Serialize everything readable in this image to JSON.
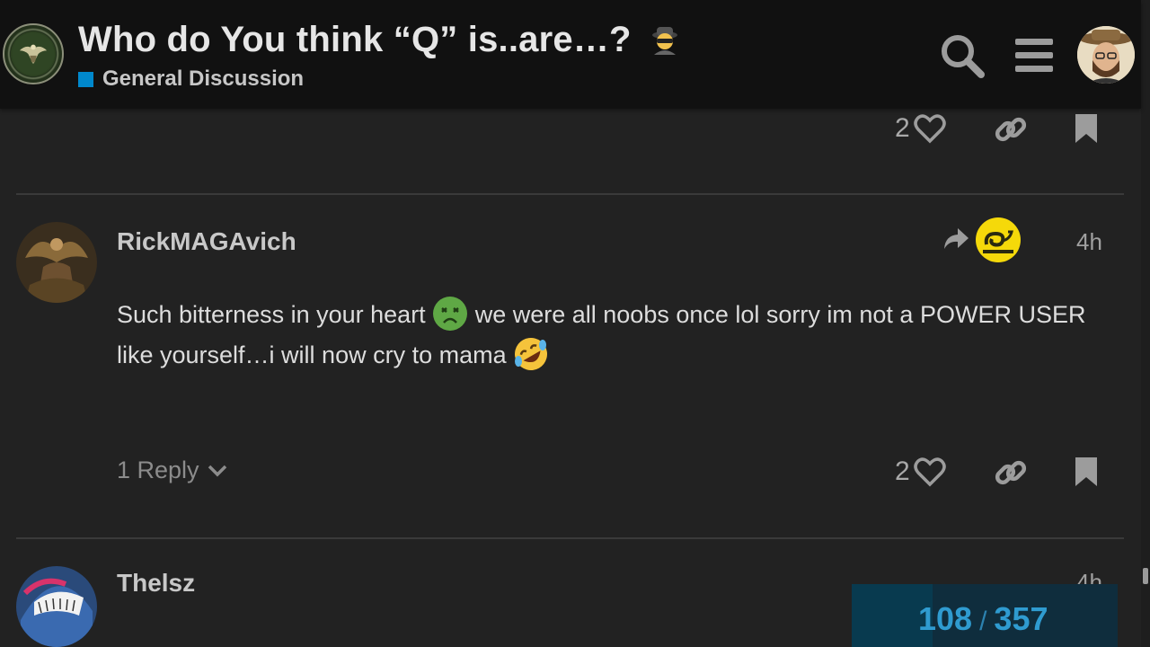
{
  "header": {
    "topic_title": "Who do You think “Q” is..are…?",
    "category": "General Discussion",
    "category_color": "#0088cc",
    "logo_name": "infowars-army-logo",
    "search_icon": "search-icon",
    "menu_icon": "hamburger-menu-icon"
  },
  "previous_post": {
    "like_count": "2"
  },
  "post": {
    "username": "RickMAGAvich",
    "date": "4h",
    "body_part1": "Such bitterness in your heart",
    "body_part2": "we were all noobs once lol sorry im not a POWER USER like yourself…i will now cry to mama",
    "reply_count_label": "1 Reply",
    "like_count": "2",
    "emoji1": "nauseated-face",
    "emoji2": "rolling-on-the-floor-laughing"
  },
  "next_post": {
    "username": "Thelsz",
    "date": "4h"
  },
  "timeline": {
    "current": "108",
    "separator": "/",
    "total": "357"
  }
}
